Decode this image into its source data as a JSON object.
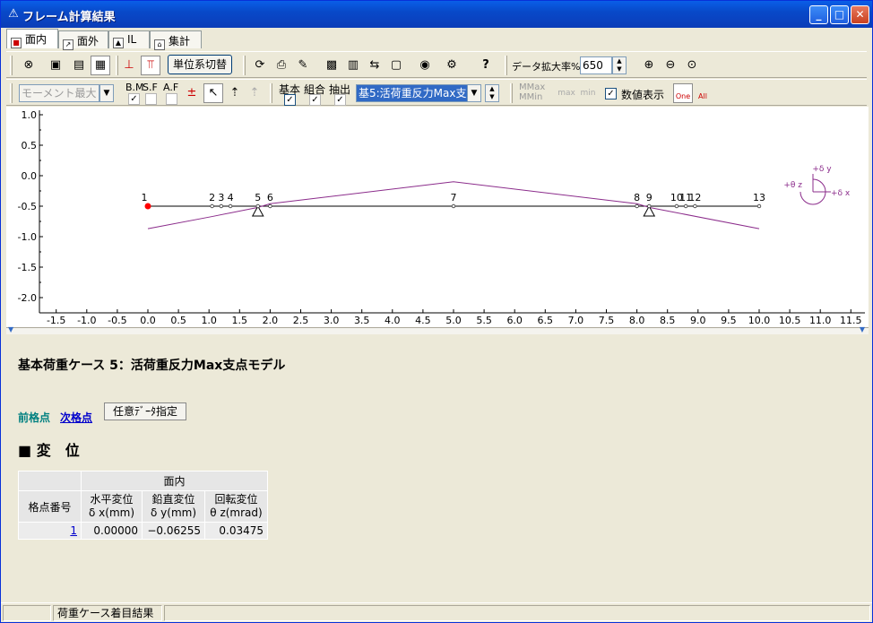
{
  "window": {
    "title": "フレーム計算結果",
    "min": "_",
    "max": "□",
    "close": "✕"
  },
  "tabs": [
    {
      "label": "面内",
      "icon": "inplane-icon",
      "active": true
    },
    {
      "label": "面外",
      "icon": "outplane-icon",
      "active": false
    },
    {
      "label": "IL",
      "icon": "il-icon",
      "active": false
    },
    {
      "label": "集計",
      "icon": "summary-icon",
      "active": false
    }
  ],
  "toolbar1": {
    "unit_button": "単位系切替",
    "zoom_label": "データ拡大率%",
    "zoom_value": "650"
  },
  "toolbar2": {
    "moment_select": "モーメント最大",
    "bm_label": "B.M",
    "sf_label": "S.F",
    "af_label": "A.F",
    "kihon": "基本",
    "kumiai": "組合",
    "chushutsu": "抽出",
    "case_select": "基5:活荷重反力Max支",
    "mmax": "MMax",
    "mmin": "MMin",
    "max_btn": "max",
    "min_btn": "min",
    "show_values": "数値表示",
    "one_btn": "One",
    "all_btn": "All"
  },
  "chart_data": {
    "type": "line",
    "y_ticks": [
      "1.0",
      "0.5",
      "0.0",
      "-0.5",
      "-1.0",
      "-1.5",
      "-2.0"
    ],
    "x_ticks": [
      "-1.5",
      "-1.0",
      "-0.5",
      "0.0",
      "0.5",
      "1.0",
      "1.5",
      "2.0",
      "2.5",
      "3.0",
      "3.5",
      "4.0",
      "4.5",
      "5.0",
      "5.5",
      "6.0",
      "6.5",
      "7.0",
      "7.5",
      "8.0",
      "8.5",
      "9.0",
      "9.5",
      "10.0",
      "10.5",
      "11.0",
      "11.5"
    ],
    "ylim": [
      -2.0,
      1.0
    ],
    "xlim": [
      -1.5,
      11.5
    ],
    "nodes": [
      {
        "label": "1",
        "x": 0.0
      },
      {
        "label": "2",
        "x": 1.05
      },
      {
        "label": "3",
        "x": 1.2
      },
      {
        "label": "4",
        "x": 1.35
      },
      {
        "label": "5",
        "x": 1.8
      },
      {
        "label": "6",
        "x": 2.0
      },
      {
        "label": "7",
        "x": 5.0
      },
      {
        "label": "8",
        "x": 8.0
      },
      {
        "label": "9",
        "x": 8.2
      },
      {
        "label": "10",
        "x": 8.65
      },
      {
        "label": "11",
        "x": 8.8
      },
      {
        "label": "12",
        "x": 8.95
      },
      {
        "label": "13",
        "x": 10.0
      }
    ],
    "member_y": -0.5,
    "supports_x": [
      1.8,
      8.2
    ],
    "series": [
      {
        "x": [
          0.0,
          1.05,
          1.8,
          2.0,
          5.0,
          8.0,
          8.2,
          10.0
        ],
        "values": [
          -0.87,
          -0.67,
          -0.52,
          -0.46,
          -0.1,
          -0.46,
          -0.52,
          -0.87
        ]
      }
    ],
    "colors": {
      "deflection": "#8B2C8B",
      "member": "#000000",
      "selected_node": "#FF0000"
    },
    "legend": {
      "dy": "+δ y",
      "tz": "+θ z",
      "dx": "+δ x"
    }
  },
  "content": {
    "heading": "基本荷重ケース 5：活荷重反力Max支点モデル",
    "prev": "前格点",
    "next": "次格点",
    "any_button": "任意ﾃﾞｰﾀ指定",
    "section": "■ 変　位",
    "table": {
      "group": "面内",
      "col_node": "格点番号",
      "col_h1": "水平変位",
      "col_h2": "δ x(mm)",
      "col_v1": "鉛直変位",
      "col_v2": "δ y(mm)",
      "col_r1": "回転変位",
      "col_r2": "θ z(mrad)",
      "row": {
        "node": "1",
        "dx": "0.00000",
        "dy": "−0.06255",
        "tz": "0.03475"
      }
    }
  },
  "status": {
    "text": "荷重ケース着目結果"
  }
}
